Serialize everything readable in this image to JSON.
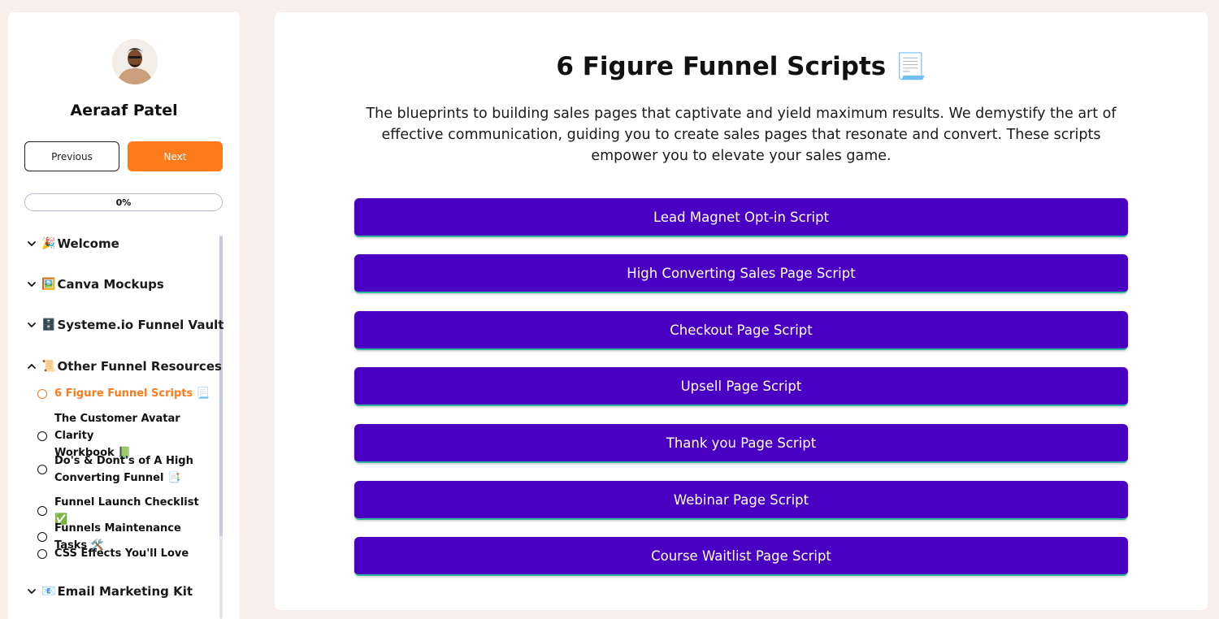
{
  "sidebar": {
    "user_name": "Aeraaf Patel",
    "prev_label": "Previous",
    "next_label": "Next",
    "progress_text": "0%",
    "progress_value": 0,
    "sections": [
      {
        "emoji": "🎉",
        "label": "Welcome",
        "expanded": false
      },
      {
        "emoji": "🖼️",
        "label": "Canva Mockups",
        "expanded": false
      },
      {
        "emoji": "🗄️",
        "label": "Systeme.io Funnel Vault",
        "expanded": false
      },
      {
        "emoji": "📜",
        "label": "Other Funnel Resources",
        "expanded": true
      },
      {
        "emoji": "📧",
        "label": "Email Marketing Kit",
        "expanded": false
      }
    ],
    "lessons": [
      {
        "line1": "6 Figure Funnel Scripts 📃",
        "line2": "",
        "active": true
      },
      {
        "line1": "The Customer Avatar Clarity",
        "line2": "Workbook 📗",
        "active": false
      },
      {
        "line1": "Do's & Dont's of A High",
        "line2": "Converting Funnel 📑",
        "active": false
      },
      {
        "line1": "Funnel Launch Checklist ✅",
        "line2": "",
        "active": false
      },
      {
        "line1": "Funnels Maintenance Tasks 🛠️",
        "line2": "",
        "active": false
      },
      {
        "line1": "CSS Effects You'll Love",
        "line2": "",
        "active": false
      }
    ]
  },
  "main": {
    "title": "6 Figure Funnel Scripts 📃",
    "description": "The blueprints to building sales pages that captivate and yield maximum results. We demystify the art of effective communication, guiding you to create sales pages that resonate and convert. These scripts empower you to elevate your sales game.",
    "scripts": [
      "Lead Magnet Opt-in Script",
      "High Converting Sales Page Script",
      "Checkout Page Script",
      "Upsell Page Script",
      "Thank you Page Script",
      "Webinar Page Script",
      "Course Waitlist Page Script"
    ]
  },
  "colors": {
    "accent": "#ff7a1a",
    "button_purple": "#4a00c2",
    "page_bg": "#f8efea"
  },
  "icons": {
    "chevron_down": "chevron-down-icon",
    "chevron_up": "chevron-up-icon",
    "lesson_status": "circle-outline-icon"
  }
}
